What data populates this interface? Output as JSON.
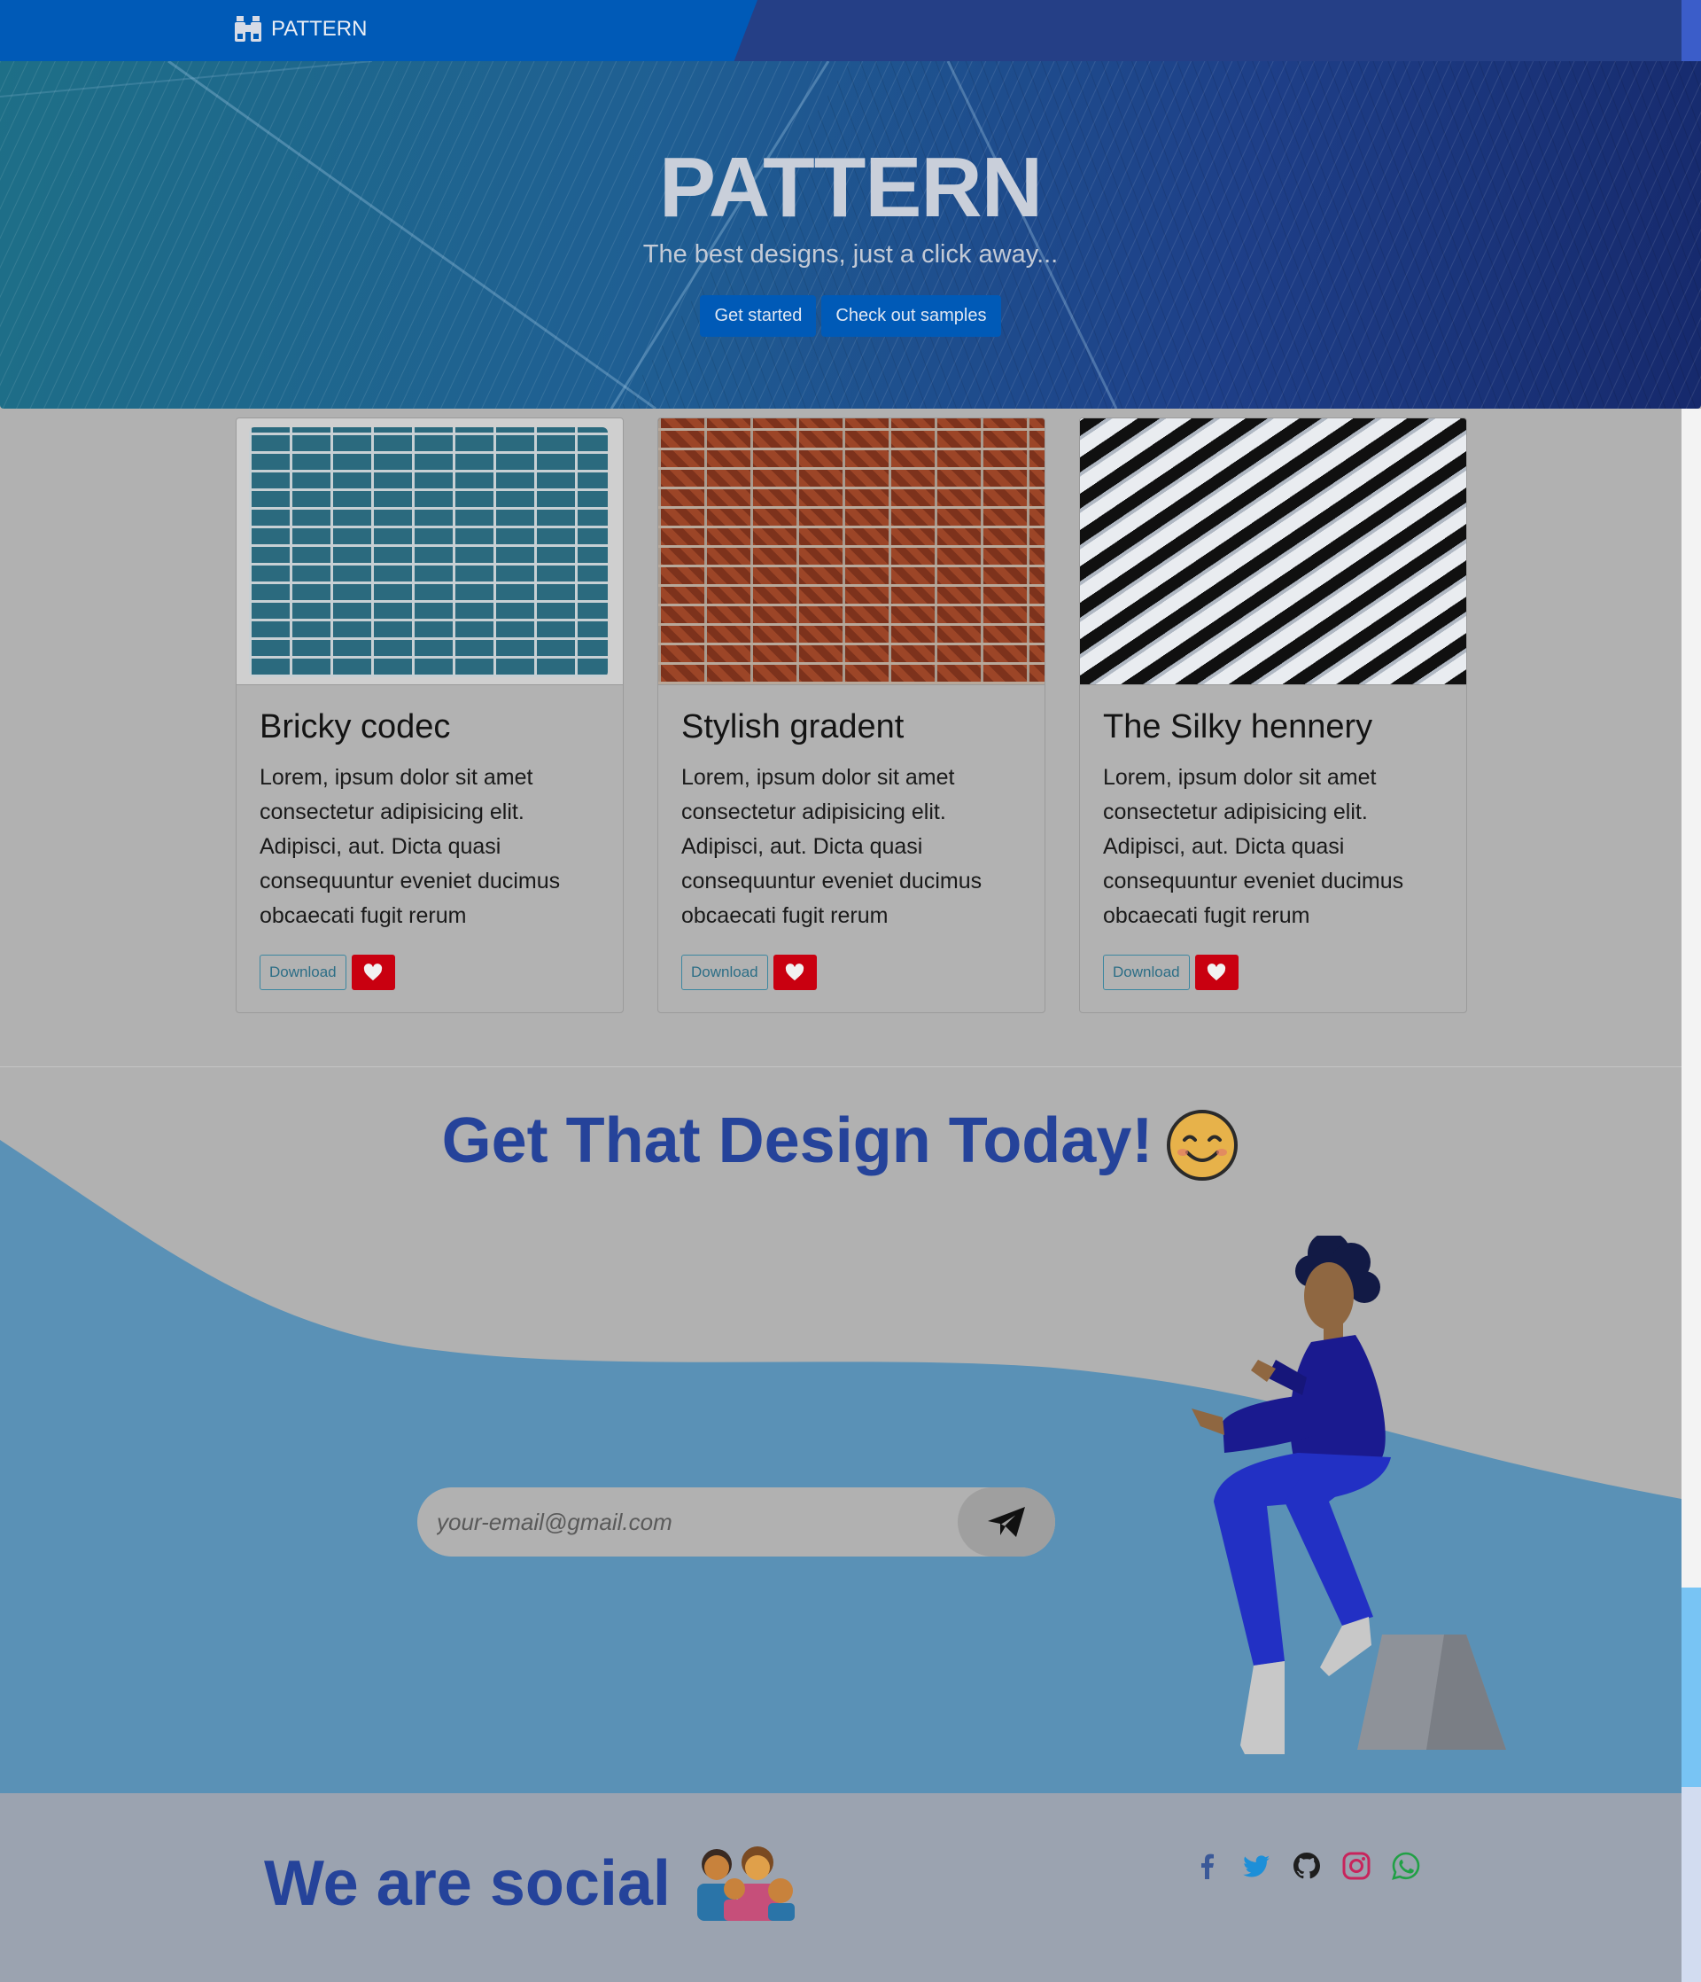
{
  "nav": {
    "brand": "PATTERN",
    "brand_icon": "binoculars-icon"
  },
  "hero": {
    "title": "PATTERN",
    "subtitle": "The best designs, just a click away...",
    "buttons": [
      "Get started",
      "Check out samples"
    ]
  },
  "cards": [
    {
      "title": "Bricky codec",
      "text": "Lorem, ipsum dolor sit amet consectetur adipisicing elit. Adipisci, aut. Dicta quasi consequuntur eveniet ducimus obcaecati fugit rerum",
      "download_label": "Download",
      "image": "blue-brick-wall"
    },
    {
      "title": "Stylish gradent",
      "text": "Lorem, ipsum dolor sit amet consectetur adipisicing elit. Adipisci, aut. Dicta quasi consequuntur eveniet ducimus obcaecati fugit rerum",
      "download_label": "Download",
      "image": "red-brick-wall"
    },
    {
      "title": "The Silky hennery",
      "text": "Lorem, ipsum dolor sit amet consectetur adipisicing elit. Adipisci, aut. Dicta quasi consequuntur eveniet ducimus obcaecati fugit rerum",
      "download_label": "Download",
      "image": "black-white-stripes"
    }
  ],
  "cta": {
    "title": "Get That Design Today!",
    "title_emoji": "smiling-face-icon",
    "email_placeholder": "your-email@gmail.com",
    "send_icon": "paper-plane-icon"
  },
  "footer": {
    "title": "We are social",
    "title_emoji": "family-icon",
    "social": [
      "facebook-icon",
      "twitter-icon",
      "github-icon",
      "instagram-icon",
      "whatsapp-icon"
    ]
  },
  "colors": {
    "nav_blue": "#005ab7",
    "nav_dark": "#253f86",
    "heading_blue": "#25439a",
    "wave_blue": "#5a91b6",
    "heart_red": "#c90010",
    "download_teal": "#3c87a0"
  }
}
